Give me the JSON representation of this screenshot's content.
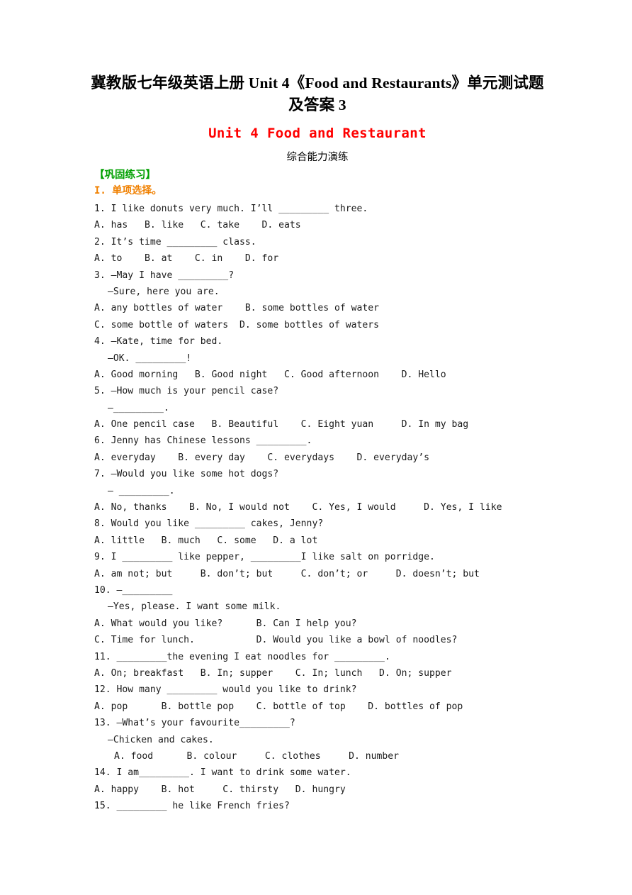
{
  "document": {
    "title_lines": [
      "冀教版七年级英语上册 Unit 4《Food and Restaurants》单元测试题",
      "及答案 3"
    ],
    "unit_heading": "Unit 4 Food and Restaurant",
    "sub_heading": "综合能力演练",
    "green_heading": "【巩固练习】",
    "section_heading": "I. 单项选择。"
  },
  "colors": {
    "unit_heading": "#ff0000",
    "green_heading": "#00A000",
    "section_heading": "#F08000",
    "body_text": "#1a1a1a",
    "page_background": "#ffffff"
  },
  "lines": [
    {
      "text": "1. I like donuts very much. I’ll _________ three.",
      "indent": 0
    },
    {
      "text": "A. has   B. like   C. take    D. eats",
      "indent": 0
    },
    {
      "text": "2. It’s time _________ class.",
      "indent": 0
    },
    {
      "text": "A. to    B. at    C. in    D. for",
      "indent": 0
    },
    {
      "text": "3. —May I have _________?",
      "indent": 0
    },
    {
      "text": "—Sure, here you are.",
      "indent": 1
    },
    {
      "text": "A. any bottles of water    B. some bottles of water",
      "indent": 0
    },
    {
      "text": "C. some bottle of waters  D. some bottles of waters",
      "indent": 0
    },
    {
      "text": "4. —Kate, time for bed.",
      "indent": 0
    },
    {
      "text": "—OK. _________!",
      "indent": 1
    },
    {
      "text": "A. Good morning   B. Good night   C. Good afternoon    D. Hello",
      "indent": 0
    },
    {
      "text": "5. —How much is your pencil case?",
      "indent": 0
    },
    {
      "text": "—_________.",
      "indent": 1
    },
    {
      "text": "A. One pencil case   B. Beautiful    C. Eight yuan     D. In my bag",
      "indent": 0
    },
    {
      "text": "6. Jenny has Chinese lessons _________.",
      "indent": 0
    },
    {
      "text": "A. everyday    B. every day    C. everydays    D. everyday’s",
      "indent": 0
    },
    {
      "text": "7. —Would you like some hot dogs?",
      "indent": 0
    },
    {
      "text": "— _________.",
      "indent": 1
    },
    {
      "text": "A. No, thanks    B. No, I would not    C. Yes, I would     D. Yes, I like",
      "indent": 0
    },
    {
      "text": "8. Would you like _________ cakes, Jenny?",
      "indent": 0
    },
    {
      "text": "A. little   B. much   C. some   D. a lot",
      "indent": 0
    },
    {
      "text": "9. I _________ like pepper, _________I like salt on porridge.",
      "indent": 0
    },
    {
      "text": "A. am not; but     B. don’t; but     C. don’t; or     D. doesn’t; but",
      "indent": 0
    },
    {
      "text": "10. —_________",
      "indent": 0
    },
    {
      "text": "—Yes, please. I want some milk.",
      "indent": 1
    },
    {
      "text": "A. What would you like?      B. Can I help you?",
      "indent": 0
    },
    {
      "text": "C. Time for lunch.           D. Would you like a bowl of noodles?",
      "indent": 0
    },
    {
      "text": "11. _________the evening I eat noodles for _________.",
      "indent": 0
    },
    {
      "text": "A. On; breakfast   B. In; supper    C. In; lunch   D. On; supper",
      "indent": 0
    },
    {
      "text": "12. How many _________ would you like to drink?",
      "indent": 0
    },
    {
      "text": "A. pop      B. bottle pop    C. bottle of top    D. bottles of pop",
      "indent": 0
    },
    {
      "text": "13. —What’s your favourite_________?",
      "indent": 0
    },
    {
      "text": "—Chicken and cakes.",
      "indent": 1
    },
    {
      "text": "A. food      B. colour     C. clothes     D. number",
      "indent": 2
    },
    {
      "text": "14. I am_________. I want to drink some water.",
      "indent": 0
    },
    {
      "text": "A. happy    B. hot     C. thirsty   D. hungry",
      "indent": 0
    },
    {
      "text": "15. _________ he like French fries?",
      "indent": 0
    }
  ]
}
